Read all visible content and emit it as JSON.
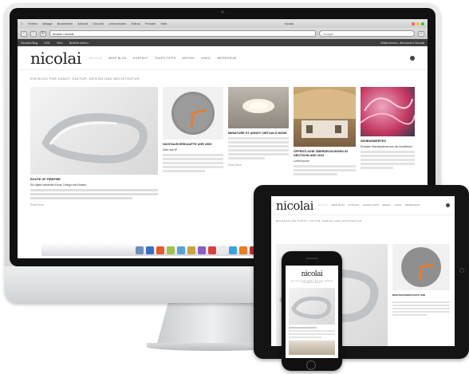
{
  "browser": {
    "menu": [
      "Firefox",
      "Ablage",
      "Bearbeiten",
      "Ansicht",
      "Chronik",
      "Lesezeichen",
      "Extras",
      "Fenster",
      "Hilfe"
    ],
    "window_title": "nicolai.",
    "url": "nicolai • nicolai",
    "search_placeholder": "Google",
    "bookmarks": [
      "Nicolai-Blog",
      "URL",
      "Neu",
      "Beliebt seiten"
    ],
    "bookmark_right": "Willkommen, Alexandra Nicolai"
  },
  "site": {
    "logo": "nicolai",
    "nav": [
      "NICOLAI",
      "MEIN BLOG",
      "KONTAKT",
      "TAGES-TIPPS",
      "ARCHIV",
      "LINKS",
      "IMPRESSUM"
    ],
    "tagline": "EIN BLOG FÜR KUNST, KULTUR, DESIGN UND ARCHITEKTUR",
    "posts": [
      {
        "title": "ROUTE OF FIREFIRE",
        "sub": "Ein objekt verbindet Kunst, Design und Nutzen",
        "more": "Read More"
      },
      {
        "title": "NICHTAUSVERKAUFTE UHR 2009",
        "sub": "Über das IP"
      },
      {
        "title": "MINIATURE ST ANNOY VIRTUALS MODE",
        "sub": "",
        "more": "Read More"
      },
      {
        "title": "ÖFFENTLICHE ÜBERDECKUNGEN IN DEUTSCHLAND 2013",
        "sub": "Lorem ipsum"
      },
      {
        "title": "SEHENSWERTES",
        "sub": "Einfache Wandsysteme aus der Architektur"
      }
    ]
  },
  "ipad": {
    "logo": "nicolai",
    "tagline": "EIN BLOG FÜR KUNST, KULTUR, DESIGN UND ARCHITEKTUR",
    "nav": [
      "NICOLAI",
      "MEIN BLOG",
      "KONTAKT",
      "TAGES-TIPPS",
      "ARCHIV",
      "LINKS",
      "IMPRESSUM"
    ],
    "post_title": "NICHTAUSVERKAUFTE UHR"
  },
  "iphone": {
    "logo": "nicolai",
    "tagline": "EIN BLOG FÜR KUNST, KULTUR, DESIGN UND ARCHITEKTUR"
  },
  "colors": {
    "clock_hand": "#f07a1f",
    "clock_face": "#8f8f8f",
    "header_dark": "#3d3d3d"
  },
  "icons": [
    "apple-icon",
    "search-icon",
    "back-icon",
    "forward-icon",
    "reload-icon",
    "home-icon"
  ]
}
